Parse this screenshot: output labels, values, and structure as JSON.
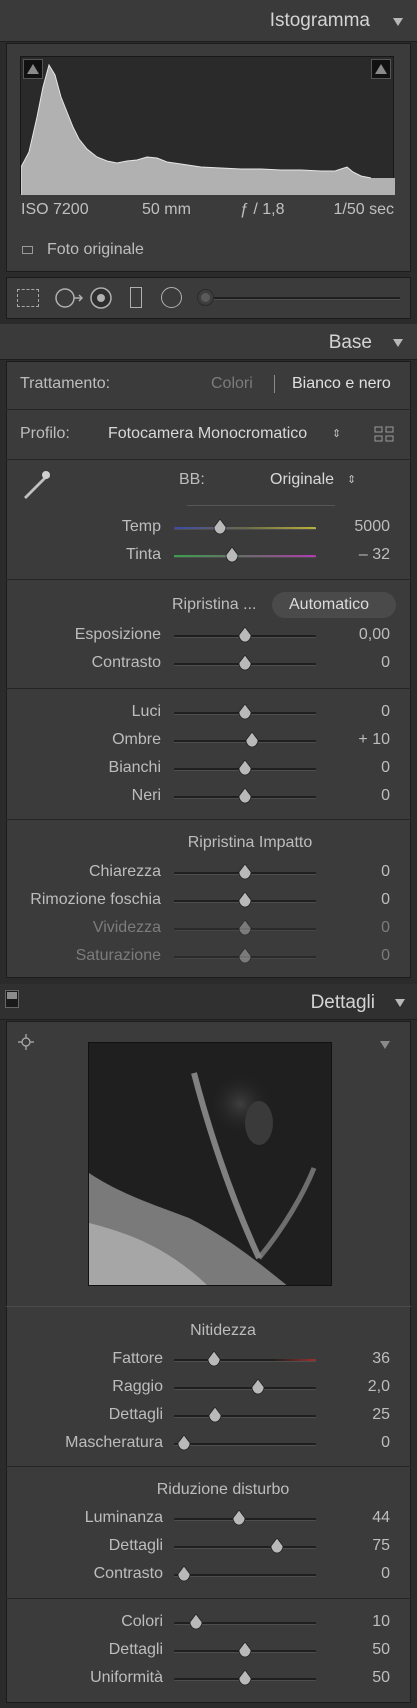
{
  "histogram": {
    "title": "Istogramma",
    "iso": "ISO 7200",
    "focal": "50 mm",
    "aperture": "ƒ / 1,8",
    "shutter": "1/50 sec",
    "original_photo_label": "Foto originale"
  },
  "base": {
    "title": "Base",
    "treatment_label": "Trattamento:",
    "treatment_color": "Colori",
    "treatment_bw": "Bianco e nero",
    "profile_label": "Profilo:",
    "profile_value": "Fotocamera Monocromatico",
    "wb_label": "BB:",
    "wb_value": "Originale",
    "temp_label": "Temp",
    "temp_value": "5000",
    "tint_label": "Tinta",
    "tint_value": "– 32",
    "tone_reset_label": "Ripristina ...",
    "tone_auto_label": "Automatico",
    "exposure_label": "Esposizione",
    "exposure_value": "0,00",
    "contrast_label": "Contrasto",
    "contrast_value": "0",
    "highlights_label": "Luci",
    "highlights_value": "0",
    "shadows_label": "Ombre",
    "shadows_value": "+ 10",
    "whites_label": "Bianchi",
    "whites_value": "0",
    "blacks_label": "Neri",
    "blacks_value": "0",
    "presence_reset_label": "Ripristina Impatto",
    "clarity_label": "Chiarezza",
    "clarity_value": "0",
    "dehaze_label": "Rimozione foschia",
    "dehaze_value": "0",
    "vibrance_label": "Vividezza",
    "vibrance_value": "0",
    "saturation_label": "Saturazione",
    "saturation_value": "0"
  },
  "detail": {
    "title": "Dettagli",
    "sharpening_title": "Nitidezza",
    "amount_label": "Fattore",
    "amount_value": "36",
    "radius_label": "Raggio",
    "radius_value": "2,0",
    "detail_label": "Dettagli",
    "detail_value": "25",
    "masking_label": "Mascheratura",
    "masking_value": "0",
    "noise_title": "Riduzione disturbo",
    "luminance_label": "Luminanza",
    "luminance_value": "44",
    "lum_detail_label": "Dettagli",
    "lum_detail_value": "75",
    "lum_contrast_label": "Contrasto",
    "lum_contrast_value": "0",
    "color_label": "Colori",
    "color_value": "10",
    "color_detail_label": "Dettagli",
    "color_detail_value": "50",
    "smoothness_label": "Uniformità",
    "smoothness_value": "50"
  },
  "colors": {
    "panel_bg": "#3b3b3b",
    "header_bg": "#3a3a3a",
    "text": "#bdbdbd",
    "dim_text": "#7c7c7c"
  },
  "icons": [
    "histogram-clip-shadow-icon",
    "histogram-clip-highlight-icon",
    "crop-icon",
    "spot-removal-icon",
    "red-eye-icon",
    "graduated-filter-icon",
    "radial-filter-icon",
    "brush-icon",
    "panel-collapse-icon",
    "profile-browser-grid-icon",
    "eyedropper-icon",
    "target-crosshair-icon"
  ]
}
